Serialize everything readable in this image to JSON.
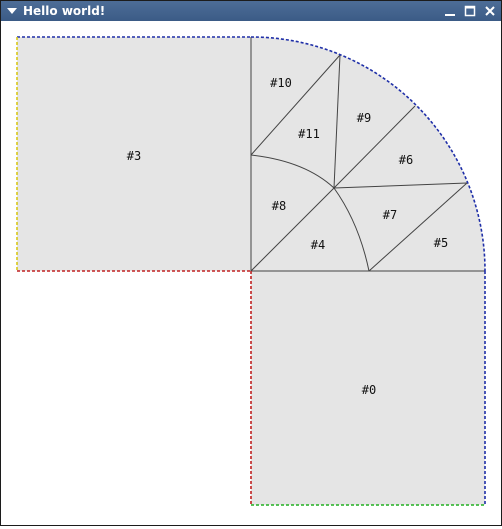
{
  "window": {
    "title": "Hello world!",
    "controls": {
      "menu_icon": "triangle-down-icon",
      "minimize_icon": "minimize-icon",
      "maximize_icon": "maximize-icon",
      "close_icon": "close-icon"
    },
    "titlebar_color": "#3f5f8a"
  },
  "mesh": {
    "fill_color": "#e5e5e5",
    "edge_color": "#444444",
    "boundary_colors": {
      "outer_arc": "#1f2fa8",
      "inner_edges": "#c02020",
      "left_end": "#d8c81a",
      "bottom_end": "#22b022"
    },
    "region_labels": {
      "r0": "#0",
      "r3": "#3",
      "r4": "#4",
      "r5": "#5",
      "r6": "#6",
      "r7": "#7",
      "r8": "#8",
      "r9": "#9",
      "r10": "#10",
      "r11": "#11"
    }
  }
}
